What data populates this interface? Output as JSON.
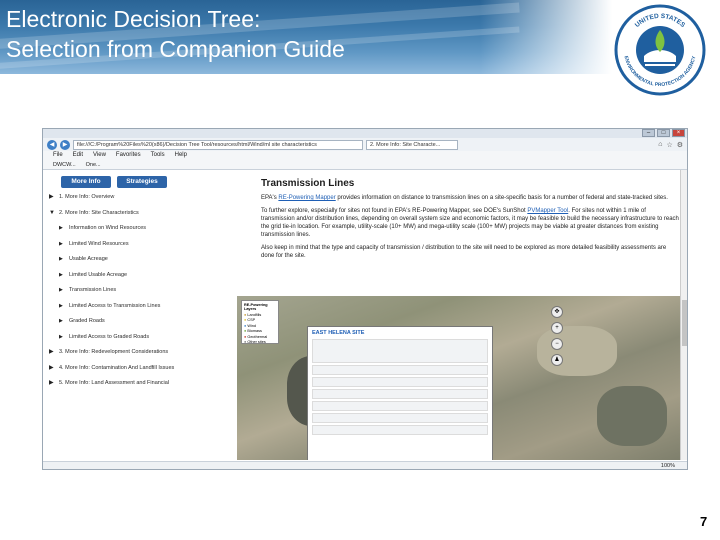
{
  "slide": {
    "title_line1": "Electronic Decision Tree:",
    "title_line2": "Selection from Companion Guide",
    "page_number": "7",
    "logo_text_top": "UNITED STATES",
    "logo_text_bottom": "ENVIRONMENTAL PROTECTION AGENCY"
  },
  "browser": {
    "url": "file:///C:/Program%20Files%20(x86)/Decision Tree Tool/resources/html/Wind/ml site characteristics",
    "tab_label": "2. More Info: Site Characte...",
    "menu": [
      "File",
      "Edit",
      "View",
      "Favorites",
      "Tools",
      "Help"
    ],
    "favorites": [
      "DWCW...",
      "One..."
    ],
    "zoom": "100%"
  },
  "sidebar": {
    "buttons": [
      "More Info",
      "Strategies"
    ],
    "items": [
      {
        "label": "1. More Info: Overview",
        "sub": false
      },
      {
        "label": "2. More Info: Site Characteristics",
        "sub": false
      },
      {
        "label": "Information on Wind Resources",
        "sub": true
      },
      {
        "label": "Limited Wind Resources",
        "sub": true
      },
      {
        "label": "Usable Acreage",
        "sub": true
      },
      {
        "label": "Limited Usable Acreage",
        "sub": true
      },
      {
        "label": "Transmission Lines",
        "sub": true
      },
      {
        "label": "Limited Access to Transmission Lines",
        "sub": true
      },
      {
        "label": "Graded Roads",
        "sub": true
      },
      {
        "label": "Limited Access to Graded Roads",
        "sub": true
      },
      {
        "label": "3. More Info: Redevelopment Considerations",
        "sub": false
      },
      {
        "label": "4. More Info: Contamination And Landfill Issues",
        "sub": false
      },
      {
        "label": "5. More Info: Land Assessment and Financial",
        "sub": false
      }
    ]
  },
  "main": {
    "title": "Transmission Lines",
    "para1_a": "EPA's ",
    "para1_link": "RE-Powering Mapper",
    "para1_b": " provides information on distance to transmission lines on a site-specific basis for a number of federal and state-tracked sites.",
    "para2_a": "To further explore, especially for sites not found in EPA's RE-Powering Mapper, see DOE's SunShot ",
    "para2_link": "PVMapper Tool",
    "para2_b": ". For sites not within 1 mile of transmission and/or distribution lines, depending on overall system size and economic factors, it may be feasible to build the necessary infrastructure to reach the grid tie-in location. For example, utility-scale (10+ MW) and mega-utility scale (100+ MW) projects may be viable at greater distances from existing transmission lines.",
    "para3": "Also keep in mind that the type and capacity of transmission / distribution to the site will need to be explored as more detailed feasibility assessments are done for the site."
  },
  "map": {
    "legend_title": "RE-Powering Layers",
    "legend_items": [
      "Landfills",
      "CSP",
      "Wind",
      "Biomass",
      "Geothermal",
      "Other sites"
    ],
    "popup_title": "EAST HELENA SITE"
  }
}
